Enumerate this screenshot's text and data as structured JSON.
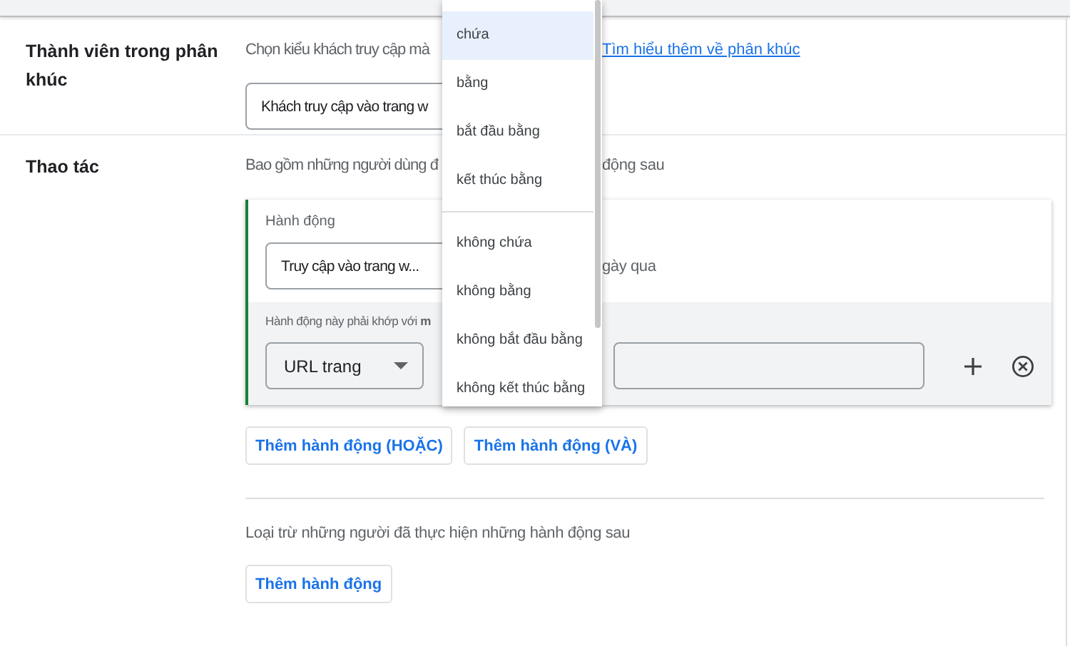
{
  "segment_membership": {
    "label": "Thành viên trong phân khúc",
    "description": "Chọn kiểu khách truy cập mà",
    "link": "Tìm hiểu thêm về phân khúc",
    "select_value": "Khách truy cập vào trang w"
  },
  "actions": {
    "label": "Thao tác",
    "description": "Bao gồm những người dùng đ",
    "description_end": "động sau",
    "card": {
      "field_label": "Hành động",
      "action_select": "Truy cập vào trang w...",
      "suffix_text": "gày qua",
      "match_label": "Hành động này phải khớp với **m**",
      "dimension_select": "URL trang"
    },
    "buttons": [
      "Thêm hành động (HOẶC)",
      "Thêm hành động (VÀ)"
    ]
  },
  "exclude": {
    "description": "Loại trừ những người đã thực hiện những hành động sau",
    "button": "Thêm hành động"
  },
  "operator_menu": {
    "items": [
      {
        "kind": "item",
        "label": "chứa",
        "selected": true
      },
      {
        "kind": "item",
        "label": "bằng",
        "selected": false
      },
      {
        "kind": "item",
        "label": "bắt đầu bằng",
        "selected": false
      },
      {
        "kind": "item",
        "label": "kết thúc bằng",
        "selected": false
      },
      {
        "kind": "divider"
      },
      {
        "kind": "item",
        "label": "không chứa",
        "selected": false
      },
      {
        "kind": "item",
        "label": "không bằng",
        "selected": false
      },
      {
        "kind": "item",
        "label": "không bắt đầu bằng",
        "selected": false
      },
      {
        "kind": "item",
        "label": "không kết thúc bằng",
        "selected": false
      }
    ]
  }
}
